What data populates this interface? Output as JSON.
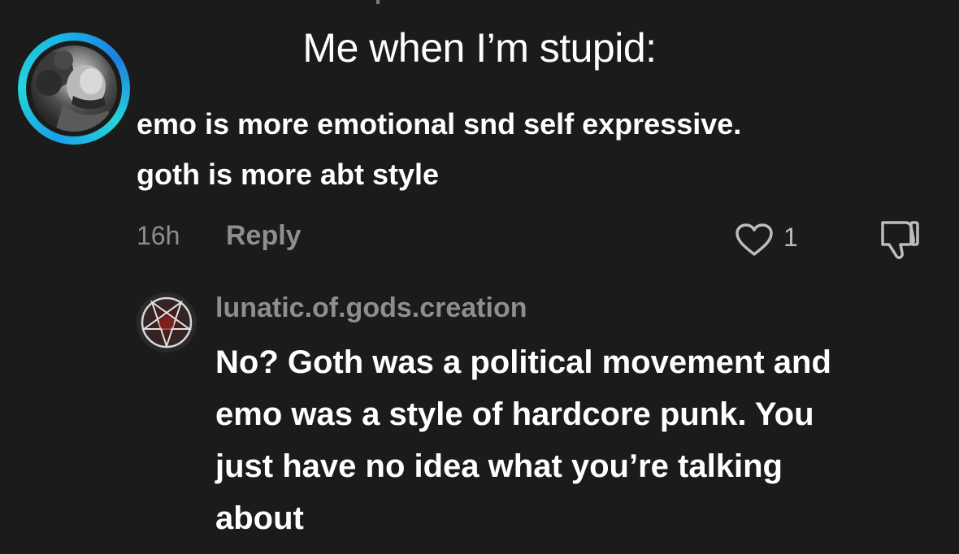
{
  "caption": "Me when I’m stupid:",
  "comment": {
    "text_line1": "emo is more emotional snd self expressive.",
    "text_line2": "goth is more abt style",
    "time": "16h",
    "reply_label": "Reply",
    "like_count": "1",
    "icons": {
      "like": "heart-icon",
      "dislike": "thumbs-down-icon",
      "avatar": "user-avatar"
    },
    "colors": {
      "avatar_ring": "#25d4d9"
    }
  },
  "reply": {
    "username": "lunatic.of.gods.creation",
    "text_line1": "No? Goth was a political movement and",
    "text_line2": "emo was a style of hardcore punk. You",
    "text_line3": "just have no idea what you’re talking",
    "text_line4": "about",
    "icons": {
      "avatar": "pentagram-avatar"
    }
  },
  "colors": {
    "background": "#1b1b1b",
    "text_primary": "#ffffff",
    "text_secondary": "#8e8e8e"
  }
}
